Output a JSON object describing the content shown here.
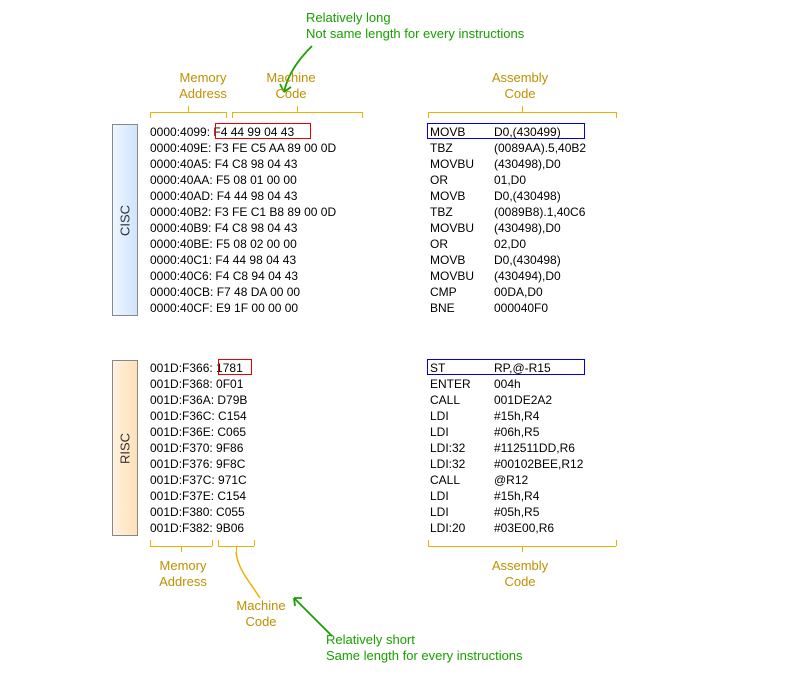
{
  "annotations": {
    "top_long": "Relatively long",
    "top_var": "Not same length for every instructions",
    "bottom_short": "Relatively short",
    "bottom_same": "Same length for every instructions"
  },
  "labels": {
    "mem_addr": "Memory",
    "mem_addr2": "Address",
    "machine_code": "Machine",
    "machine_code2": "Code",
    "asm_code": "Assembly",
    "asm_code2": "Code"
  },
  "arch": {
    "cisc": "CISC",
    "risc": "RISC"
  },
  "cisc_rows": [
    {
      "addr": "0000:4099:",
      "mc": "F4 44 99 04 43",
      "mn": "MOVB",
      "op": "D0,(430499)"
    },
    {
      "addr": "0000:409E:",
      "mc": "F3 FE C5 AA 89 00 0D",
      "mn": "TBZ",
      "op": "(0089AA).5,40B2"
    },
    {
      "addr": "0000:40A5:",
      "mc": "F4 C8 98 04 43",
      "mn": "MOVBU",
      "op": "(430498),D0"
    },
    {
      "addr": "0000:40AA:",
      "mc": "F5 08 01 00 00",
      "mn": "OR",
      "op": "01,D0"
    },
    {
      "addr": "0000:40AD:",
      "mc": "F4 44 98 04 43",
      "mn": "MOVB",
      "op": "D0,(430498)"
    },
    {
      "addr": "0000:40B2:",
      "mc": "F3 FE C1 B8 89 00 0D",
      "mn": "TBZ",
      "op": "(0089B8).1,40C6"
    },
    {
      "addr": "0000:40B9:",
      "mc": "F4 C8 98 04 43",
      "mn": "MOVBU",
      "op": "(430498),D0"
    },
    {
      "addr": "0000:40BE:",
      "mc": "F5 08 02 00 00",
      "mn": "OR",
      "op": "02,D0"
    },
    {
      "addr": "0000:40C1:",
      "mc": "F4 44 98 04 43",
      "mn": "MOVB",
      "op": "D0,(430498)"
    },
    {
      "addr": "0000:40C6:",
      "mc": "F4 C8 94 04 43",
      "mn": "MOVBU",
      "op": "(430494),D0"
    },
    {
      "addr": "0000:40CB:",
      "mc": "F7 48 DA 00 00",
      "mn": "CMP",
      "op": "00DA,D0"
    },
    {
      "addr": "0000:40CF:",
      "mc": "E9 1F 00 00 00",
      "mn": "BNE",
      "op": "000040F0"
    }
  ],
  "risc_rows": [
    {
      "addr": "001D:F366:",
      "mc": "1781",
      "mn": "ST",
      "op": "RP,@-R15"
    },
    {
      "addr": "001D:F368:",
      "mc": "0F01",
      "mn": "ENTER",
      "op": "004h"
    },
    {
      "addr": "001D:F36A:",
      "mc": "D79B",
      "mn": "CALL",
      "op": "001DE2A2"
    },
    {
      "addr": "001D:F36C:",
      "mc": "C154",
      "mn": "LDI",
      "op": "#15h,R4"
    },
    {
      "addr": "001D:F36E:",
      "mc": "C065",
      "mn": "LDI",
      "op": "#06h,R5"
    },
    {
      "addr": "001D:F370:",
      "mc": "9F86",
      "mn": "LDI:32",
      "op": "#112511DD,R6"
    },
    {
      "addr": "001D:F376:",
      "mc": "9F8C",
      "mn": "LDI:32",
      "op": "#00102BEE,R12"
    },
    {
      "addr": "001D:F37C:",
      "mc": "971C",
      "mn": "CALL",
      "op": "@R12"
    },
    {
      "addr": "001D:F37E:",
      "mc": "C154",
      "mn": "LDI",
      "op": "#15h,R4"
    },
    {
      "addr": "001D:F380:",
      "mc": "C055",
      "mn": "LDI",
      "op": "#05h,R5"
    },
    {
      "addr": "001D:F382:",
      "mc": "9B06",
      "mn": "LDI:20",
      "op": "#03E00,R6"
    }
  ]
}
